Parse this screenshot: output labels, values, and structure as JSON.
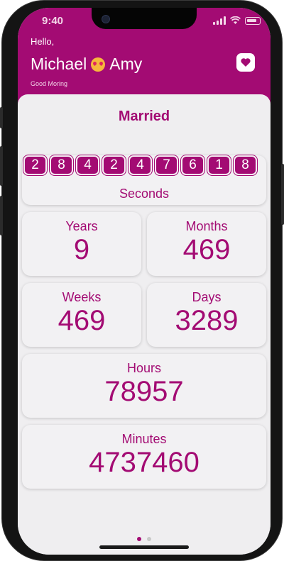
{
  "status_bar": {
    "time": "9:40"
  },
  "header": {
    "hello": "Hello,",
    "name_left": "Michael",
    "name_right": "Amy",
    "greeting": "Good Moring",
    "heart_icon": "heart-icon",
    "emoji_icon": "heart-eyes-emoji-icon"
  },
  "title": "Married",
  "seconds": {
    "digits": [
      "2",
      "8",
      "4",
      "2",
      "4",
      "7",
      "6",
      "1",
      "8"
    ],
    "label": "Seconds"
  },
  "stats": {
    "years": {
      "label": "Years",
      "value": "9"
    },
    "months": {
      "label": "Months",
      "value": "469"
    },
    "weeks": {
      "label": "Weeks",
      "value": "469"
    },
    "days": {
      "label": "Days",
      "value": "3289"
    },
    "hours": {
      "label": "Hours",
      "value": "78957"
    },
    "minutes": {
      "label": "Minutes",
      "value": "4737460"
    }
  },
  "pager": {
    "page_count": 2,
    "active_page": 1
  },
  "colors": {
    "brand": "#a30b73",
    "background": "#efeef0",
    "card": "#f2f1f3"
  }
}
